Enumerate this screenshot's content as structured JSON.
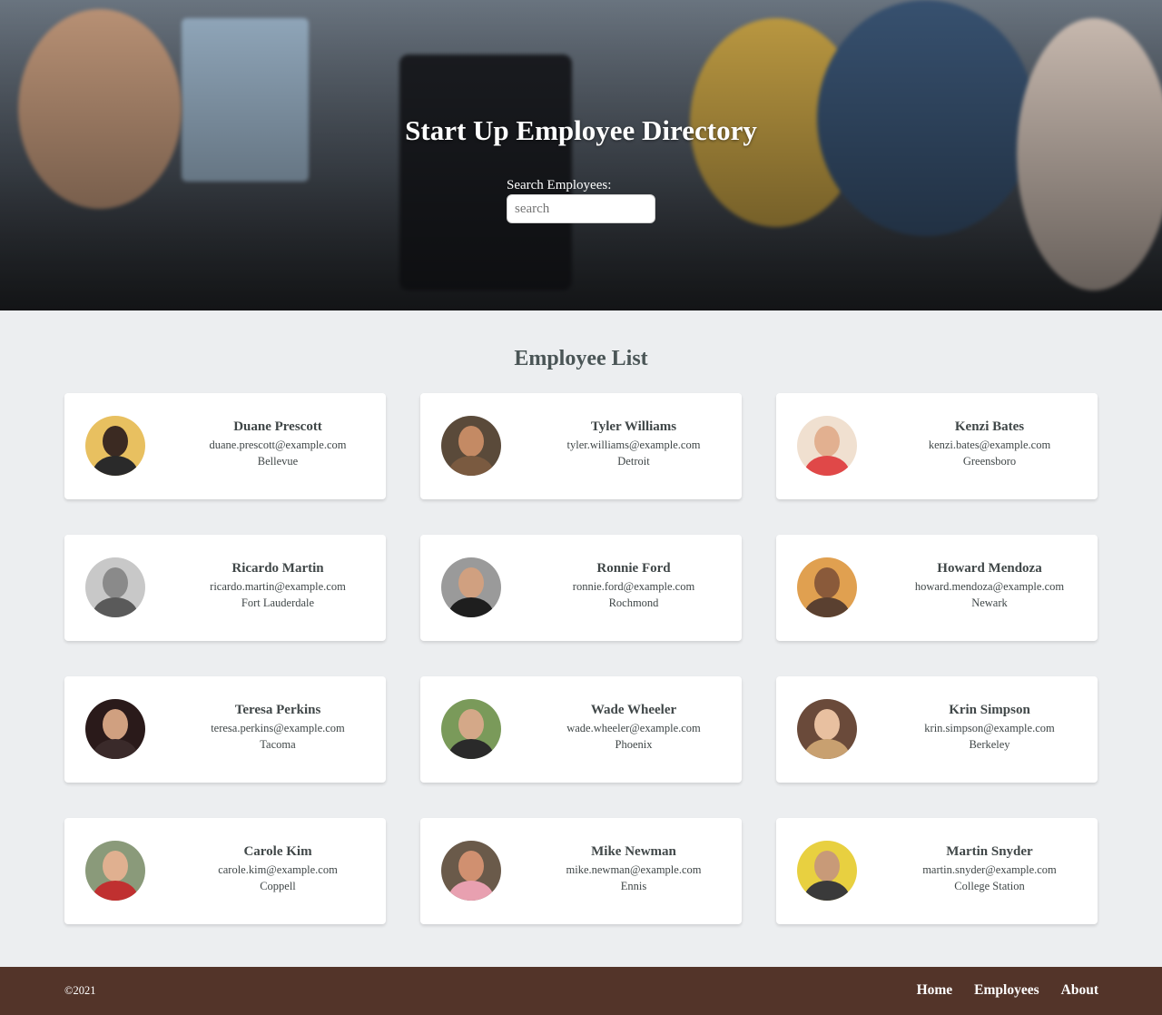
{
  "hero": {
    "title": "Start Up Employee Directory",
    "search_label": "Search Employees:",
    "search_placeholder": "search"
  },
  "main": {
    "list_title": "Employee List"
  },
  "employees": [
    {
      "name": "Duane Prescott",
      "email": "duane.prescott@example.com",
      "city": "Bellevue"
    },
    {
      "name": "Tyler Williams",
      "email": "tyler.williams@example.com",
      "city": "Detroit"
    },
    {
      "name": "Kenzi Bates",
      "email": "kenzi.bates@example.com",
      "city": "Greensboro"
    },
    {
      "name": "Ricardo Martin",
      "email": "ricardo.martin@example.com",
      "city": "Fort Lauderdale"
    },
    {
      "name": "Ronnie Ford",
      "email": "ronnie.ford@example.com",
      "city": "Rochmond"
    },
    {
      "name": "Howard Mendoza",
      "email": "howard.mendoza@example.com",
      "city": "Newark"
    },
    {
      "name": "Teresa Perkins",
      "email": "teresa.perkins@example.com",
      "city": "Tacoma"
    },
    {
      "name": "Wade Wheeler",
      "email": "wade.wheeler@example.com",
      "city": "Phoenix"
    },
    {
      "name": "Krin Simpson",
      "email": "krin.simpson@example.com",
      "city": "Berkeley"
    },
    {
      "name": "Carole Kim",
      "email": "carole.kim@example.com",
      "city": "Coppell"
    },
    {
      "name": "Mike Newman",
      "email": "mike.newman@example.com",
      "city": "Ennis"
    },
    {
      "name": "Martin Snyder",
      "email": "martin.snyder@example.com",
      "city": "College Station"
    }
  ],
  "footer": {
    "copyright": "©2021",
    "nav": [
      "Home",
      "Employees",
      "About"
    ]
  },
  "colors": {
    "page_background": "#eceef0",
    "card_background": "#ffffff",
    "footer_background": "#533429",
    "heading_text": "#4a5556"
  },
  "icons": {
    "avatar": "employee-photo"
  }
}
